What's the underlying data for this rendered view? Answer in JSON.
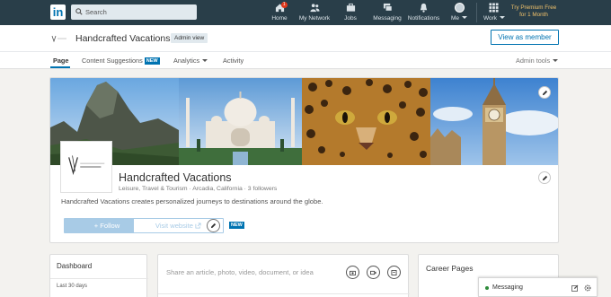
{
  "nav": {
    "logo": "in",
    "search_placeholder": "Search",
    "items": [
      {
        "label": "Home",
        "badge": "1"
      },
      {
        "label": "My Network"
      },
      {
        "label": "Jobs"
      },
      {
        "label": "Messaging"
      },
      {
        "label": "Notifications"
      },
      {
        "label": "Me"
      },
      {
        "label": "Work"
      }
    ],
    "premium": [
      "Try Premium Free",
      "for 1 Month"
    ]
  },
  "admin": {
    "company_name": "Handcrafted Vacations",
    "admin_view": "Admin view",
    "view_as_member": "View as member"
  },
  "tabs": {
    "page": "Page",
    "content_suggestions": "Content Suggestions",
    "new_tag": "NEW",
    "analytics": "Analytics",
    "activity": "Activity",
    "admin_tools": "Admin tools"
  },
  "profile": {
    "name": "Handcrafted Vacations",
    "meta": "Leisure, Travel & Tourism · Arcadia, California · 3 followers",
    "description": "Handcrafted Vacations creates personalized journeys to destinations around the globe.",
    "follow": "+ Follow",
    "visit_website": "Visit website",
    "new_badge": "NEW",
    "logo_text": "HANDCRAFTED VACATIONS"
  },
  "dashboard": {
    "title": "Dashboard",
    "subtitle": "Last 30 days"
  },
  "share": {
    "placeholder": "Share an article, photo, video, document, or idea"
  },
  "career": {
    "title": "Career Pages"
  },
  "messaging": {
    "label": "Messaging",
    "status_color": "#2e8b3a"
  },
  "colors": {
    "nav_bg": "#293e49",
    "accent": "#0073b1",
    "premium": "#f2c26b"
  }
}
